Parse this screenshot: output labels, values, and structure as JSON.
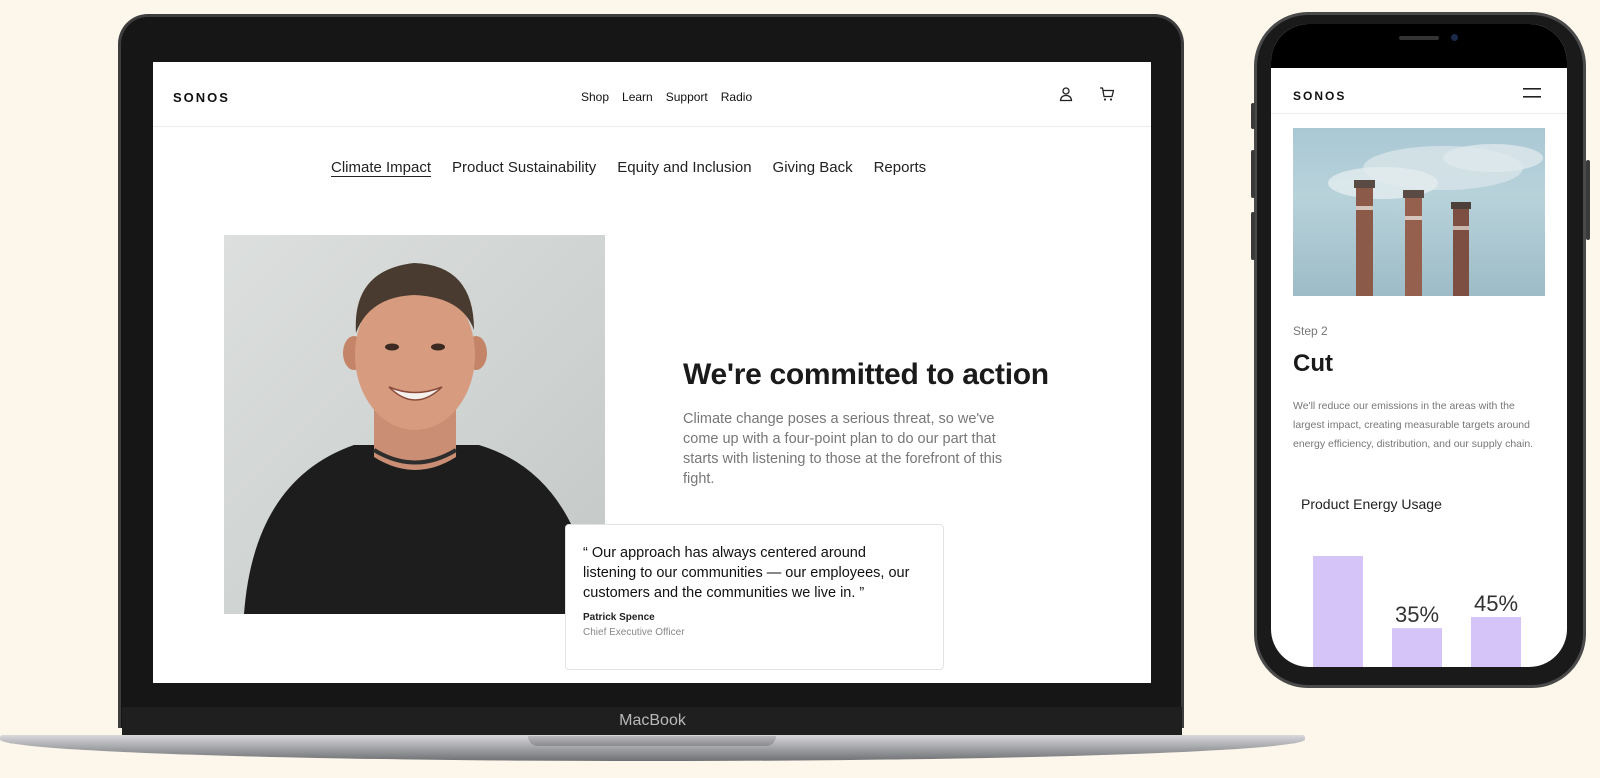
{
  "laptop": {
    "brand_label": "MacBook",
    "site": {
      "logo": "SONOS",
      "nav": [
        "Shop",
        "Learn",
        "Support",
        "Radio"
      ],
      "header_icons": [
        "user-icon",
        "cart-icon"
      ],
      "subnav": [
        {
          "label": "Climate Impact",
          "active": true
        },
        {
          "label": "Product Sustainability",
          "active": false
        },
        {
          "label": "Equity and Inclusion",
          "active": false
        },
        {
          "label": "Giving Back",
          "active": false
        },
        {
          "label": "Reports",
          "active": false
        }
      ],
      "headline": "We're committed to action",
      "intro": "Climate change poses a serious threat, so we've come up with a four-point plan to do our part that starts with listening to those at the forefront of this fight.",
      "quote": {
        "text": "“ Our approach has always centered around listening to our communities — our employees, our customers and the communities we live in. ”",
        "author": "Patrick Spence",
        "role": "Chief Executive Officer"
      }
    }
  },
  "phone": {
    "logo": "SONOS",
    "menu_icon": "hamburger-menu-icon",
    "step_label": "Step 2",
    "step_title": "Cut",
    "step_text": "We'll reduce our emissions in the areas with the largest impact, creating measurable targets around energy efficiency, distribution, and our supply chain.",
    "chart_title": "Product Energy Usage"
  },
  "colors": {
    "background": "#fdf6ea",
    "bar": "#d5c4f8",
    "text_dark": "#1a1a1a",
    "text_muted": "#777777"
  },
  "chart_data": {
    "type": "bar",
    "title": "Product Energy Usage",
    "categories": [
      "",
      "",
      ""
    ],
    "values": [
      100,
      35,
      45
    ],
    "data_labels": [
      "",
      "35%",
      "45%"
    ],
    "ylim": [
      0,
      100
    ]
  }
}
